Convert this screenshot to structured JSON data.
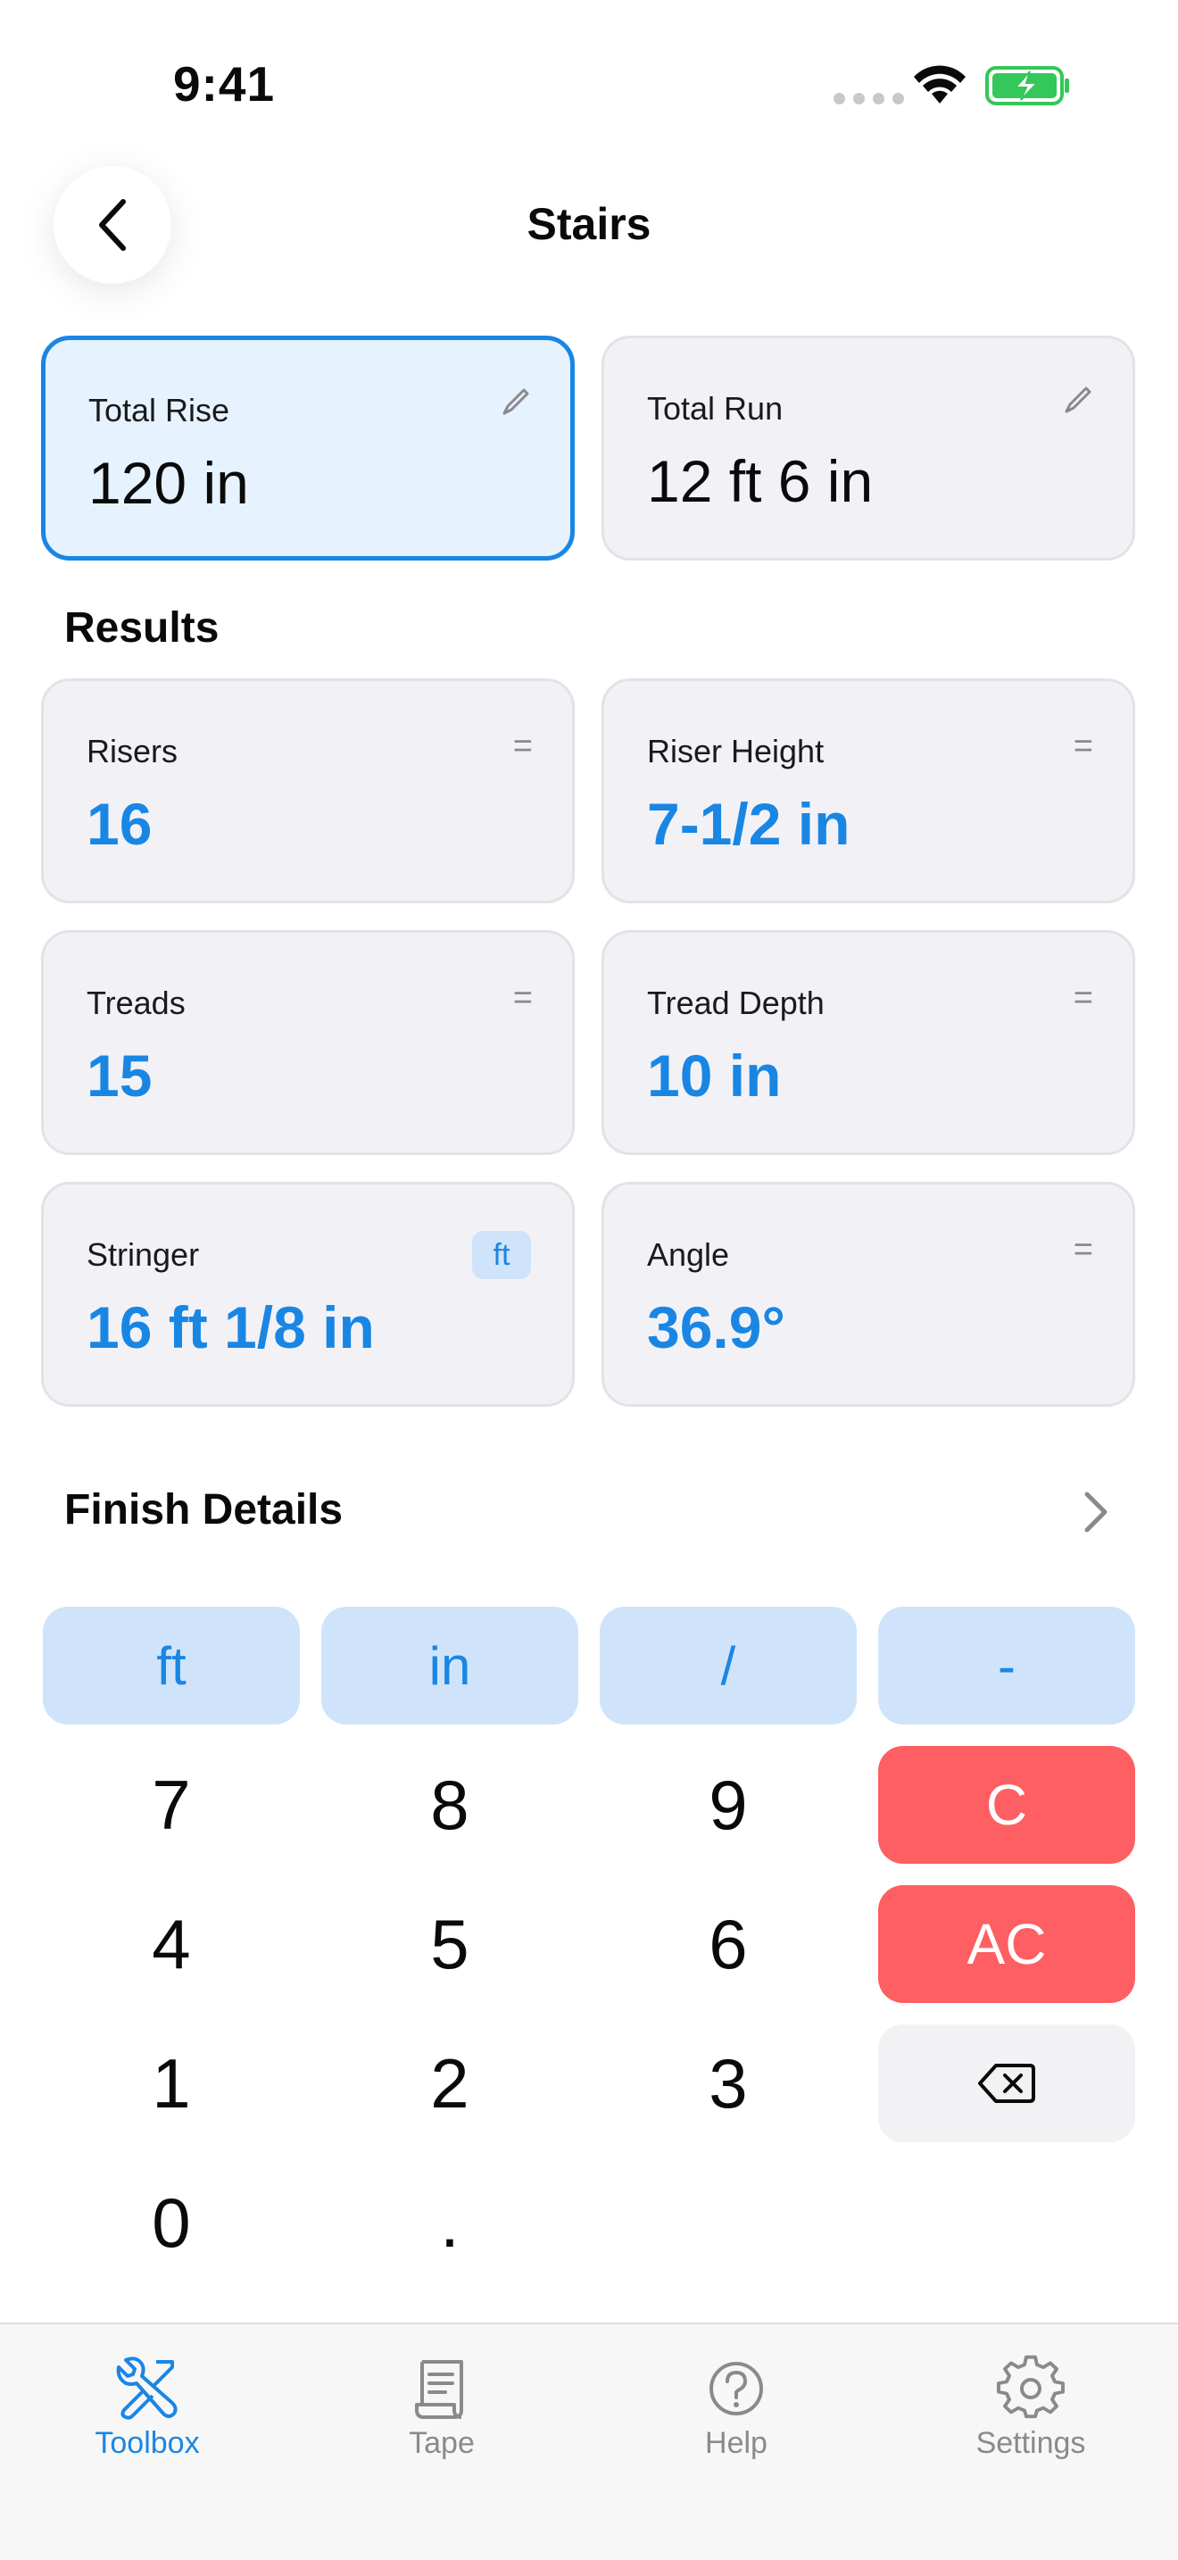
{
  "status": {
    "time": "9:41"
  },
  "nav": {
    "title": "Stairs"
  },
  "inputs": [
    {
      "label": "Total Rise",
      "value": "120 in",
      "active": true
    },
    {
      "label": "Total Run",
      "value": "12 ft 6 in",
      "active": false
    }
  ],
  "results_title": "Results",
  "results": [
    {
      "label": "Risers",
      "value": "16",
      "marker": "="
    },
    {
      "label": "Riser Height",
      "value": "7-1/2 in",
      "marker": "="
    },
    {
      "label": "Treads",
      "value": "15",
      "marker": "="
    },
    {
      "label": "Tread Depth",
      "value": "10 in",
      "marker": "="
    },
    {
      "label": "Stringer",
      "value": "16 ft 1/8 in",
      "badge": "ft"
    },
    {
      "label": "Angle",
      "value": "36.9°",
      "marker": "="
    }
  ],
  "finish": {
    "title": "Finish Details"
  },
  "keypad": {
    "units": [
      "ft",
      "in",
      "/",
      "-"
    ],
    "digits": [
      "7",
      "8",
      "9",
      "4",
      "5",
      "6",
      "1",
      "2",
      "3",
      "0",
      "."
    ],
    "clear": "C",
    "all_clear": "AC"
  },
  "tabs": [
    {
      "label": "Toolbox",
      "icon": "tools-icon",
      "active": true
    },
    {
      "label": "Tape",
      "icon": "scroll-icon",
      "active": false
    },
    {
      "label": "Help",
      "icon": "help-icon",
      "active": false
    },
    {
      "label": "Settings",
      "icon": "gear-icon",
      "active": false
    }
  ],
  "colors": {
    "accent": "#1a86e4",
    "danger": "#fe5f62",
    "card": "#f2f2f6",
    "unit_key": "#cfe4fa"
  }
}
